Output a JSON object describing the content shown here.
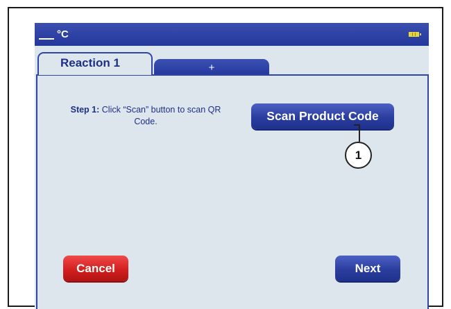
{
  "status_bar": {
    "temperature_value": "",
    "temperature_unit": "°C",
    "battery_icon": "battery-icon"
  },
  "tabs": [
    {
      "label": "Reaction 1",
      "active": true
    },
    {
      "label": "+",
      "active": false
    }
  ],
  "step": {
    "label": "Step 1:",
    "text": "Click “Scan” button to scan QR Code."
  },
  "buttons": {
    "scan_label": "Scan Product Code",
    "cancel_label": "Cancel",
    "next_label": "Next"
  },
  "callout": {
    "number": "1"
  },
  "colors": {
    "primary_blue": "#2a3e9f",
    "cancel_red": "#d41f1f",
    "panel_background": "#dde6ec",
    "battery_yellow": "#e7d43c"
  }
}
